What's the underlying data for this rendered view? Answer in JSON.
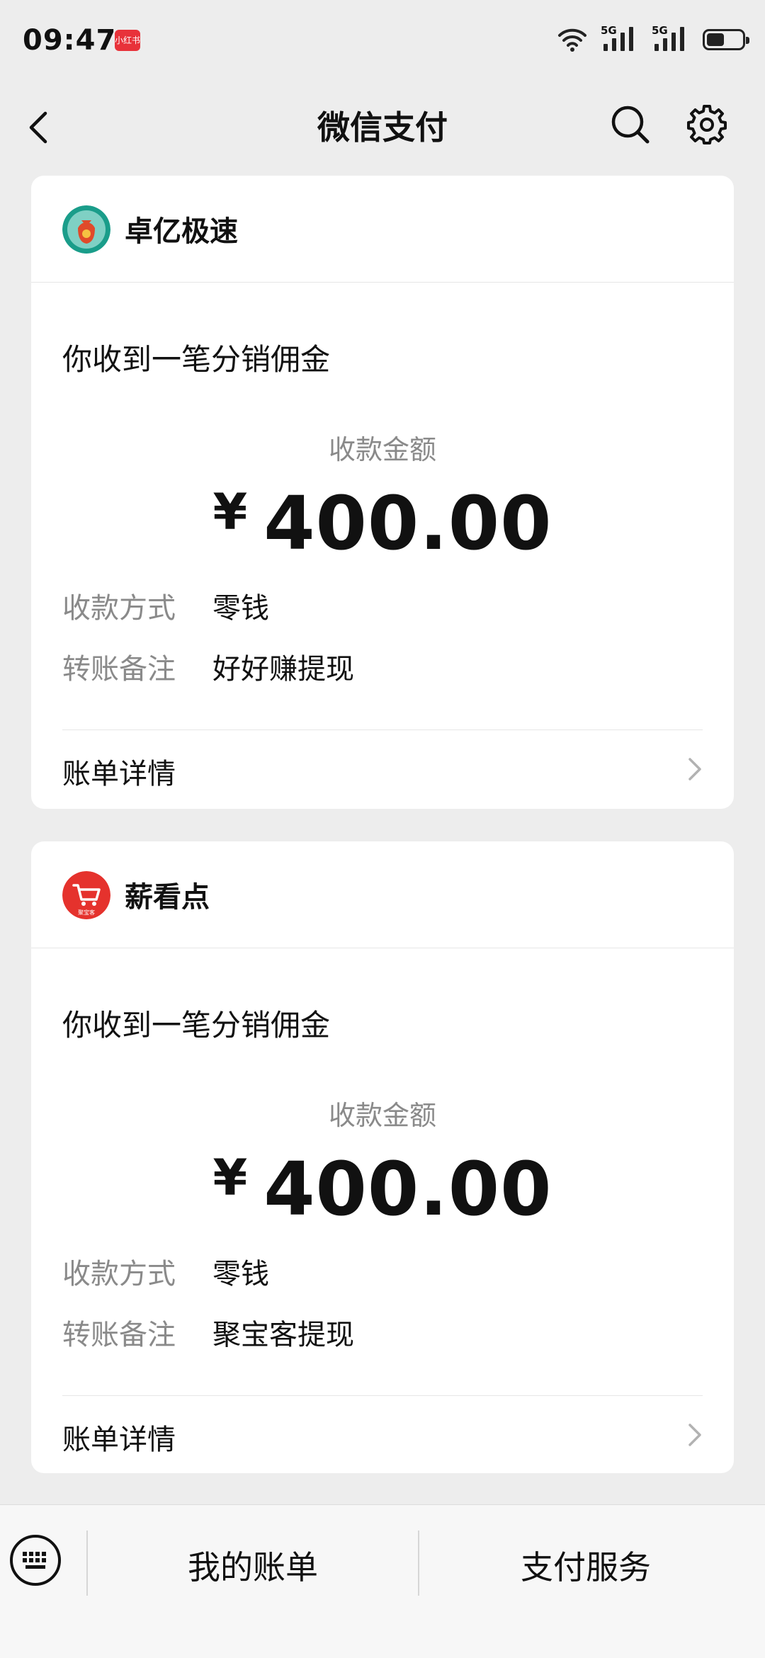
{
  "status_bar": {
    "time": "09:47",
    "app_badge": "小红书",
    "signal1_label": "5G",
    "signal2_label": "5G",
    "battery_level_percent": 50
  },
  "header": {
    "title": "微信支付",
    "back_icon": "chevron-left-icon",
    "search_icon": "search-icon",
    "settings_icon": "gear-icon"
  },
  "messages": [
    {
      "merchant": "卓亿极速",
      "subject": "你收到一笔分销佣金",
      "amount_label": "收款金额",
      "currency": "¥",
      "amount": "400.00",
      "method_label": "收款方式",
      "method_value": "零钱",
      "note_label": "转账备注",
      "note_value": "好好赚提现",
      "bill_label": "账单详情"
    },
    {
      "merchant": "薪看点",
      "logo_text": "聚宝客",
      "subject": "你收到一笔分销佣金",
      "amount_label": "收款金额",
      "currency": "¥",
      "amount": "400.00",
      "method_label": "收款方式",
      "method_value": "零钱",
      "note_label": "转账备注",
      "note_value": "聚宝客提现",
      "bill_label": "账单详情"
    }
  ],
  "bottom_bar": {
    "keyboard_icon": "keyboard-icon",
    "tab1": "我的账单",
    "tab2": "支付服务"
  },
  "colors": {
    "background": "#ededed",
    "card": "#ffffff",
    "label_gray": "#8a8a8a",
    "logo1_bg": "#1a9d8a",
    "logo2_bg": "#e5322d"
  }
}
